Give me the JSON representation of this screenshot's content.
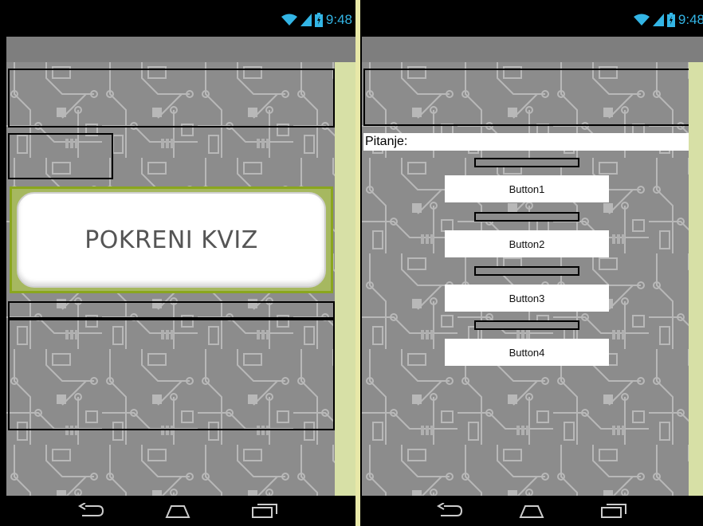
{
  "status": {
    "time": "9:48"
  },
  "start_screen": {
    "start_button_label": "POKRENI KVIZ"
  },
  "quiz_screen": {
    "question_label": "Pitanje:",
    "answers": [
      "Button1",
      "Button2",
      "Button3",
      "Button4"
    ]
  },
  "colors": {
    "status_icon": "#33b5e5",
    "title_bar": "#7e7e7e",
    "side_strip": "#d7e0a6",
    "start_button_border": "#8aa61e"
  },
  "icons": {
    "wifi": "wifi-icon",
    "signal": "signal-icon",
    "battery": "battery-icon",
    "back": "back-icon",
    "home": "home-icon",
    "recents": "recent-apps-icon"
  }
}
